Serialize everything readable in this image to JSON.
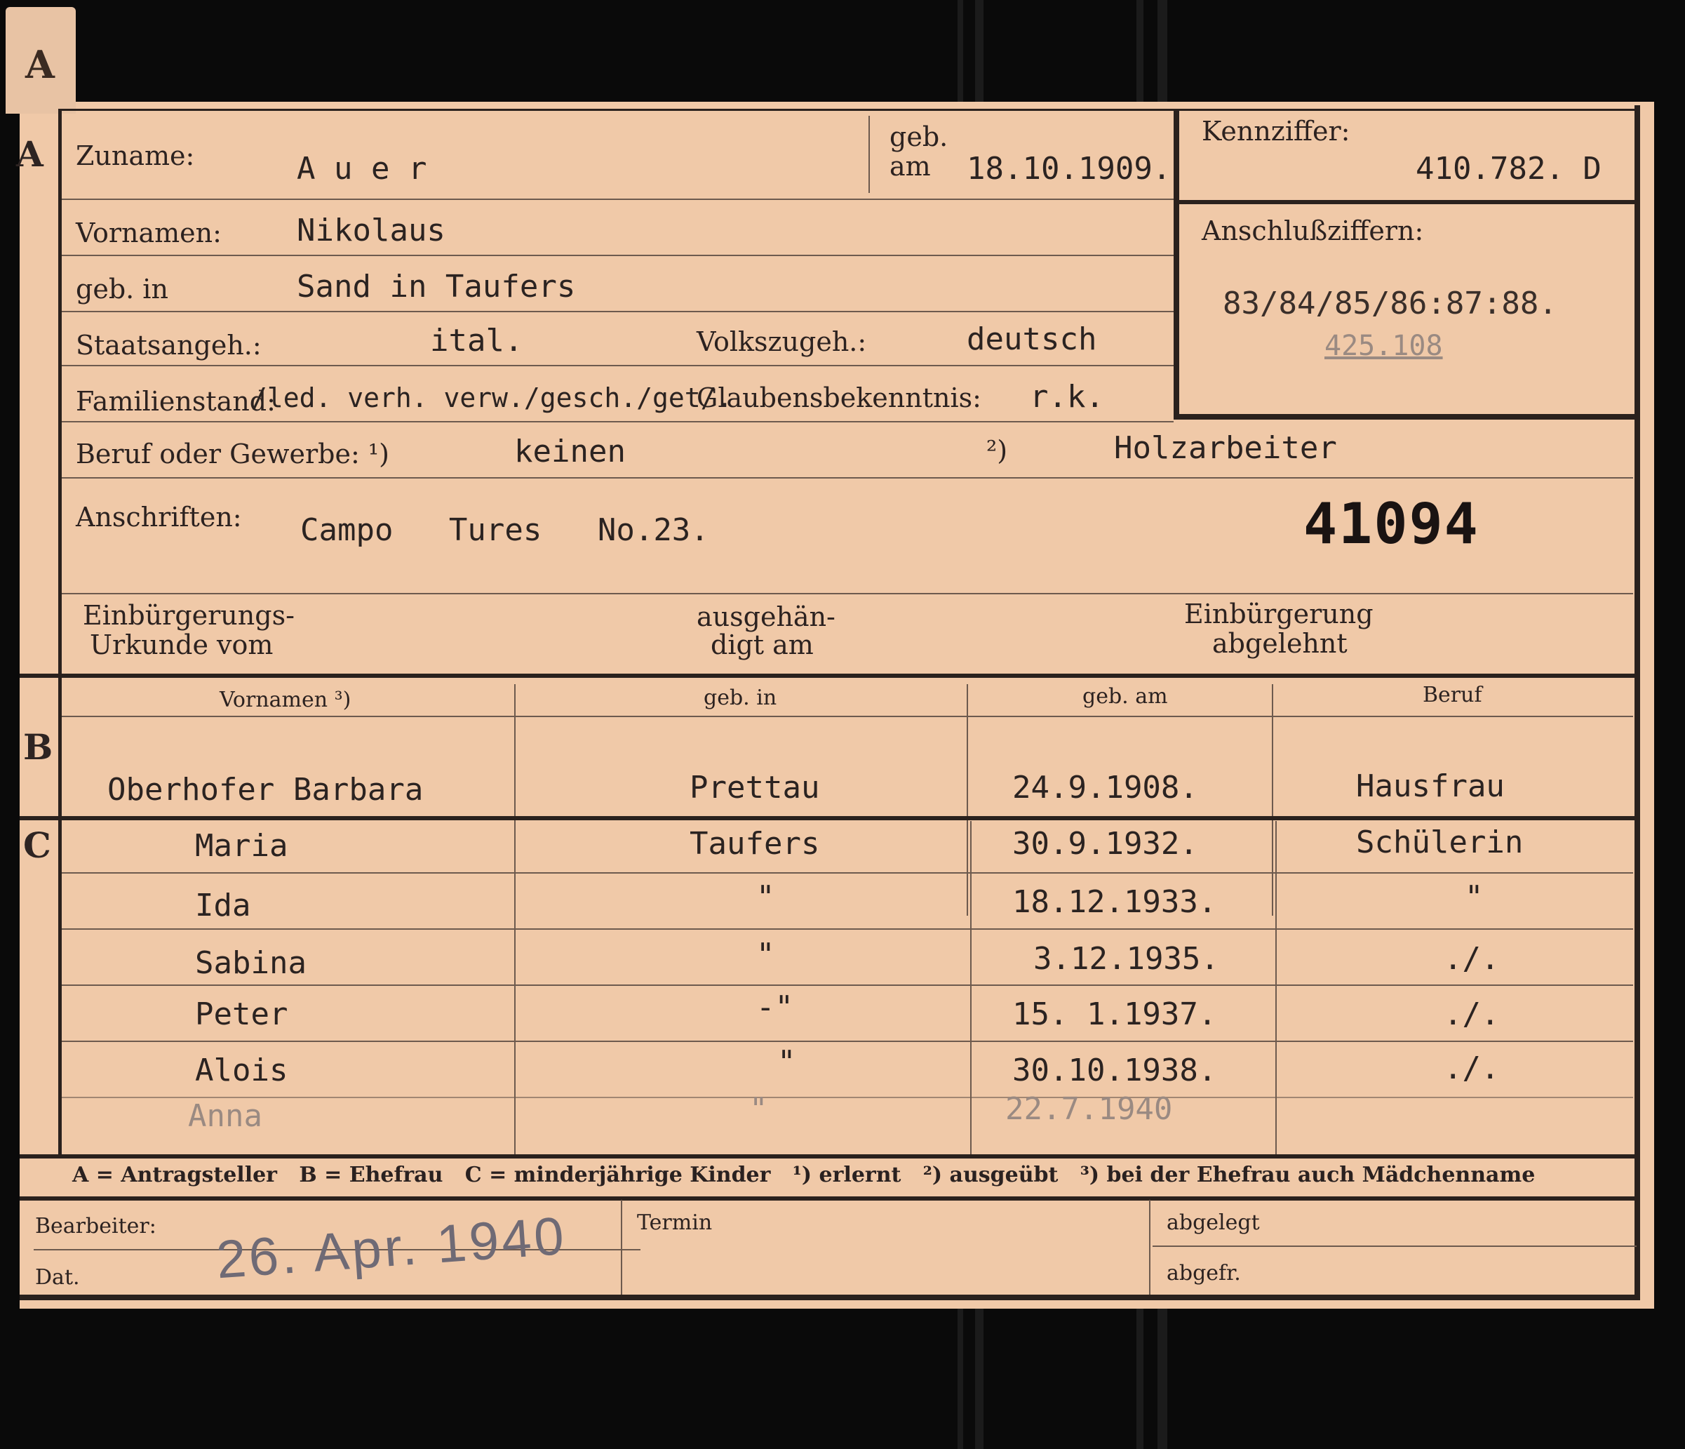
{
  "tab_letter": "A",
  "section_a": {
    "letter": "A",
    "zuname_label": "Zuname:",
    "zuname_value": "A u e r",
    "geb_am_label_1": "geb.",
    "geb_am_label_2": "am",
    "geb_am_value": "18.10.1909.",
    "kennziffer_label": "Kennziffer:",
    "kennziffer_value": "410.782. D",
    "vornamen_label": "Vornamen:",
    "vornamen_value": "Nikolaus",
    "anschluss_label": "Anschlußziffern:",
    "anschluss_value": "83/84/85/86:87:88.",
    "anschluss_extra": "425.108",
    "geb_in_label": "geb. in",
    "geb_in_value": "Sand in Taufers",
    "staatsangeh_label": "Staatsangeh.:",
    "staatsangeh_value": "ital.",
    "volkszugeh_label": "Volkszugeh.:",
    "volkszugeh_value": "deutsch",
    "familienstand_label": "Familienstand:",
    "familienstand_value": "/led. verh. verw./gesch./get/.",
    "glauben_label": "Glaubensbekenntnis:",
    "glauben_value": "r.k.",
    "beruf_label": "Beruf oder Gewerbe: ¹)",
    "beruf_value_1": "keinen",
    "beruf_mark_2": "²)",
    "beruf_value_2": "Holzarbeiter",
    "anschriften_label": "Anschriften:",
    "anschriften_value": "Campo   Tures   No.23.",
    "number": "41094",
    "einb_label_1": "Einbürgerungs-",
    "einb_label_2": "Urkunde vom",
    "ausgeh_label_1": "ausgehän-",
    "ausgeh_label_2": "digt am",
    "abgelehnt_label_1": "Einbürgerung",
    "abgelehnt_label_2": "abgelehnt"
  },
  "section_b": {
    "letter": "B",
    "headers": [
      "Vornamen ³)",
      "geb. in",
      "geb. am",
      "Beruf"
    ],
    "row": [
      "Oberhofer Barbara",
      "Prettau",
      "24.9.1908.",
      "Hausfrau"
    ]
  },
  "section_c": {
    "letter": "C",
    "rows": [
      {
        "name": "Maria",
        "place": "Taufers",
        "date": "30.9.1932.",
        "job": "Schülerin"
      },
      {
        "name": "Ida",
        "place": "\"",
        "date": "18.12.1933.",
        "job": "\""
      },
      {
        "name": "Sabina",
        "place": "\"",
        "date": "3.12.1935.",
        "job": "./."
      },
      {
        "name": "Peter",
        "place": "-\"",
        "date": "15. 1.1937.",
        "job": "./."
      },
      {
        "name": "Alois",
        "place": "\"",
        "date": "30.10.1938.",
        "job": "./."
      },
      {
        "name": "Anna",
        "place": "\"",
        "date": "22.7.1940",
        "job": ""
      }
    ]
  },
  "legend": "A = Antragsteller   B = Ehefrau   C = minderjährige Kinder   ¹) erlernt   ²) ausgeübt   ³) bei der Ehefrau auch Mädchenname",
  "footer": {
    "bearbeiter_label": "Bearbeiter:",
    "dat_label": "Dat.",
    "stamp": "26. Apr. 1940",
    "termin_label": "Termin",
    "abgelegt_label": "abgelegt",
    "abgefr_label": "abgefr."
  }
}
